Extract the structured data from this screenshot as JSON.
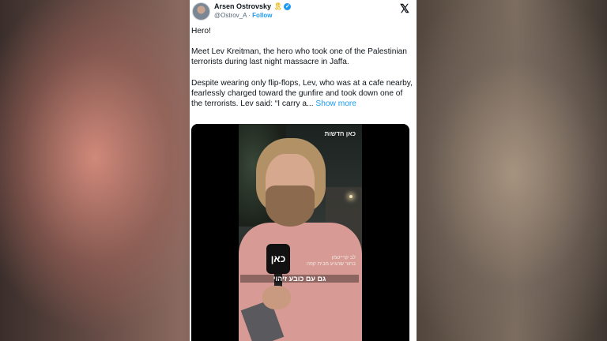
{
  "tweet": {
    "author_name": "Arsen Ostrovsky",
    "handle": "@Ostrov_A",
    "separator": "·",
    "follow_label": "Follow",
    "paragraph1": "Hero!",
    "paragraph2": "Meet Lev Kreitman, the hero who took one of the Palestinian terrorists during last night massacre in Jaffa.",
    "paragraph3": "Despite wearing only flip-flops, Lev, who was at a cafe nearby, fearlessly charged toward the gunfire and took down one of the terrorists.  Lev said: “I carry a...",
    "show_more_label": "Show more"
  },
  "media": {
    "watermark": "כאן חדשות",
    "mic_label": "כאן",
    "caption_name": "לב קרייטמן\nבחור שהגיע מבית קפה",
    "subtitle": "גם עם כובע זיהוי"
  },
  "icons": {
    "ribbon": "yellow-ribbon-icon",
    "verified": "verified-badge-icon",
    "x_logo": "x-logo-icon"
  },
  "colors": {
    "link": "#1d9bf0",
    "text": "#0f1419",
    "muted": "#536471"
  }
}
